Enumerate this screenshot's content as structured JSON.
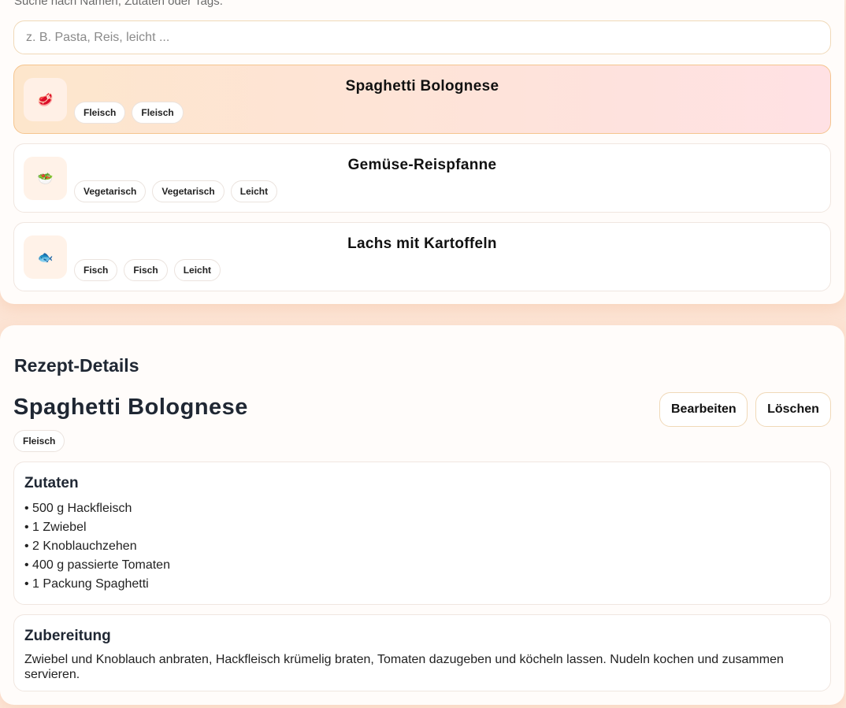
{
  "search": {
    "hint": "Suche nach Namen, Zutaten oder Tags.",
    "placeholder": "z. B. Pasta, Reis, leicht ..."
  },
  "recipes": [
    {
      "title": "Spaghetti Bolognese",
      "icon": "meat-icon",
      "tags": [
        "Fleisch",
        "Fleisch"
      ],
      "selected": true
    },
    {
      "title": "Gemüse-Reispfanne",
      "icon": "salad-bowl-icon",
      "tags": [
        "Vegetarisch",
        "Vegetarisch",
        "Leicht"
      ],
      "selected": false
    },
    {
      "title": "Lachs mit Kartoffeln",
      "icon": "fish-icon",
      "tags": [
        "Fisch",
        "Fisch",
        "Leicht"
      ],
      "selected": false
    }
  ],
  "detail": {
    "heading": "Rezept-Details",
    "title": "Spaghetti Bolognese",
    "edit_label": "Bearbeiten",
    "delete_label": "Löschen",
    "tag": "Fleisch",
    "ingredients_title": "Zutaten",
    "ingredients": [
      "• 500 g Hackfleisch",
      "• 1 Zwiebel",
      "• 2 Knoblauchzehen",
      "• 400 g passierte Tomaten",
      "• 1 Packung Spaghetti"
    ],
    "steps_title": "Zubereitung",
    "steps_text": "Zwiebel und Knoblauch anbraten, Hackfleisch krümelig braten, Tomaten dazugeben und köcheln lassen. Nudeln kochen und zusammen servieren."
  },
  "colors": {
    "accent_border": "#f5c58f",
    "text_dark": "#1f2733"
  }
}
